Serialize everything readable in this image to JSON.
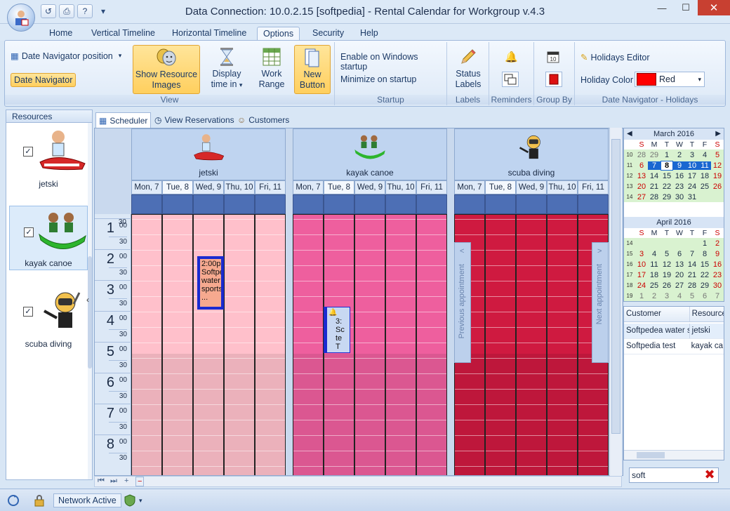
{
  "window": {
    "title": "Data Connection: 10.0.2.15 [softpedia] - Rental Calendar for Workgroup v.4.3",
    "minimize_glyph": "—",
    "maximize_glyph": "☐",
    "close_glyph": "✕"
  },
  "qat": {
    "overflow_glyph": "▾"
  },
  "ribbon_tabs": [
    "Home",
    "Vertical Timeline",
    "Horizontal Timeline",
    "Options",
    "Security",
    "Help"
  ],
  "active_tab": "Options",
  "ribbon": {
    "view": {
      "label": "View",
      "date_nav_position": "Date Navigator position",
      "date_navigator": "Date Navigator",
      "show_resource_images_1": "Show Resource",
      "show_resource_images_2": "Images",
      "display_time_1": "Display",
      "display_time_2": "time in",
      "work_range_1": "Work",
      "work_range_2": "Range",
      "new_button_1": "New",
      "new_button_2": "Button"
    },
    "startup": {
      "label": "Startup",
      "enable": "Enable on Windows startup",
      "minimize": "Minimize on startup"
    },
    "labels": {
      "label": "Labels",
      "status_1": "Status",
      "status_2": "Labels"
    },
    "reminders": {
      "label": "Reminders"
    },
    "group_by": {
      "label": "Group By"
    },
    "holidays": {
      "label": "Date Navigator - Holidays",
      "editor": "Holidays Editor",
      "color_label": "Holiday Color",
      "color_value": "Red",
      "color_hex": "#ff0000"
    }
  },
  "resources_panel": {
    "header": "Resources",
    "items": [
      {
        "name": "jetski",
        "checked": true,
        "selected": false
      },
      {
        "name": "kayak canoe",
        "checked": true,
        "selected": true
      },
      {
        "name": "scuba diving",
        "checked": true,
        "selected": false
      }
    ],
    "check_glyph": "✓",
    "collapse_glyph": "‹"
  },
  "view_tabs": [
    "Scheduler",
    "View Reservations",
    "Customers"
  ],
  "scheduler": {
    "resources": [
      {
        "name": "jetski",
        "color": "#ffc0cb"
      },
      {
        "name": "kayak canoe",
        "color": "#ee5f9e"
      },
      {
        "name": "scuba diving",
        "color": "#cf1a40"
      }
    ],
    "days": [
      "Mon, 7",
      "Tue, 8",
      "Wed, 9",
      "Thu, 10",
      "Fri, 11"
    ],
    "hours": [
      "1",
      "2",
      "3",
      "4",
      "5",
      "6",
      "7",
      "8"
    ],
    "min00": "00",
    "min30": "30",
    "prev_appointment": "Previous appointment",
    "next_appointment": "Next appointment",
    "prev_glyph": "<",
    "next_glyph": ">",
    "appointments": [
      {
        "lines": [
          "2:00p",
          "Softpe",
          "water",
          "sports",
          "..."
        ]
      },
      {
        "lines": [
          "3:",
          "Sc",
          "te",
          "",
          "T"
        ]
      }
    ],
    "bottom_nav": [
      "⏮",
      "⏭",
      "+",
      "−"
    ]
  },
  "calendars": [
    {
      "title": "March 2016",
      "prev_glyph": "◀",
      "next_glyph": "▶",
      "dow": [
        "S",
        "M",
        "T",
        "W",
        "T",
        "F",
        "S"
      ],
      "weeks": [
        {
          "wk": "10",
          "days": [
            "28",
            "29",
            "1",
            "2",
            "3",
            "4",
            "5"
          ]
        },
        {
          "wk": "11",
          "days": [
            "6",
            "7",
            "8",
            "9",
            "10",
            "11",
            "12"
          ]
        },
        {
          "wk": "12",
          "days": [
            "13",
            "14",
            "15",
            "16",
            "17",
            "18",
            "19"
          ]
        },
        {
          "wk": "13",
          "days": [
            "20",
            "21",
            "22",
            "23",
            "24",
            "25",
            "26"
          ]
        },
        {
          "wk": "14",
          "days": [
            "27",
            "28",
            "29",
            "30",
            "31",
            "",
            ""
          ]
        }
      ]
    },
    {
      "title": "April 2016",
      "dow": [
        "S",
        "M",
        "T",
        "W",
        "T",
        "F",
        "S"
      ],
      "weeks": [
        {
          "wk": "14",
          "days": [
            "",
            "",
            "",
            "",
            "",
            "1",
            "2"
          ]
        },
        {
          "wk": "15",
          "days": [
            "3",
            "4",
            "5",
            "6",
            "7",
            "8",
            "9"
          ]
        },
        {
          "wk": "16",
          "days": [
            "10",
            "11",
            "12",
            "13",
            "14",
            "15",
            "16"
          ]
        },
        {
          "wk": "17",
          "days": [
            "17",
            "18",
            "19",
            "20",
            "21",
            "22",
            "23"
          ]
        },
        {
          "wk": "18",
          "days": [
            "24",
            "25",
            "26",
            "27",
            "28",
            "29",
            "30"
          ]
        },
        {
          "wk": "19",
          "days": [
            "1",
            "2",
            "3",
            "4",
            "5",
            "6",
            "7"
          ]
        }
      ]
    }
  ],
  "customer_list": {
    "columns": [
      "Customer",
      "Resource"
    ],
    "rows": [
      [
        "Softpedea water sp",
        "jetski"
      ],
      [
        "Softpedia test",
        "kayak ca"
      ]
    ]
  },
  "search": {
    "value": "soft",
    "clear_glyph": "✖"
  },
  "status_bar": {
    "network": "Network Active",
    "dropdown_glyph": "▾"
  }
}
